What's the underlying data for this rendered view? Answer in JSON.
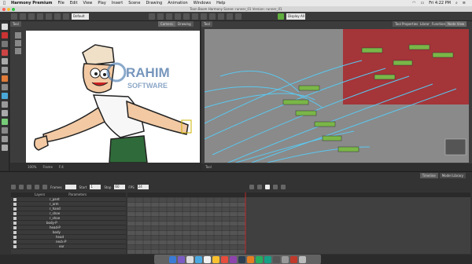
{
  "menubar": {
    "app": "Harmony Premium",
    "items": [
      "File",
      "Edit",
      "View",
      "Play",
      "Insert",
      "Scene",
      "Drawing",
      "Animation",
      "Windows",
      "Help"
    ],
    "clock": "Fri 4:22 PM"
  },
  "titlebar": {
    "title": "Toon Boom Harmony Scene: runner_01 Version: runner_01"
  },
  "toolbar": {
    "mode_select": "Default",
    "display_select": "Display All"
  },
  "camera": {
    "tab_label": "Tool",
    "tab_camera": "Camera",
    "tab_drawing": "Drawing",
    "footer_zoom": "100%",
    "footer_drawing": "Frame",
    "footer_frame": "F:4"
  },
  "nodeview": {
    "tab_label": "Tool",
    "tabs": [
      "Tool Properties",
      "Library",
      "Function",
      "Node View"
    ],
    "footer": "Tool"
  },
  "timeline": {
    "tabs": [
      "Timeline",
      "Model Library"
    ],
    "frames_label": "Frames",
    "start_label": "Start",
    "stop_label": "Stop",
    "start_value": "1",
    "stop_value": "60",
    "fps_label": "FPS",
    "fps_value": "24",
    "layers_header": "Layers",
    "params_header": "Parameters",
    "layers": [
      "r_pant",
      "r_arm",
      "r_hand",
      "r_shoe",
      "r_shoe",
      "body-P",
      "head-P",
      "body",
      "head",
      "neck-P",
      "ear"
    ]
  },
  "watermark": {
    "line1": "RAHIM",
    "line2": "SOFTWARE"
  },
  "colors": {
    "accent": "#c0282b",
    "node_bg": "#8a8a8a",
    "node_wire": "#5ac8f0",
    "node_green": "#7ab648"
  }
}
